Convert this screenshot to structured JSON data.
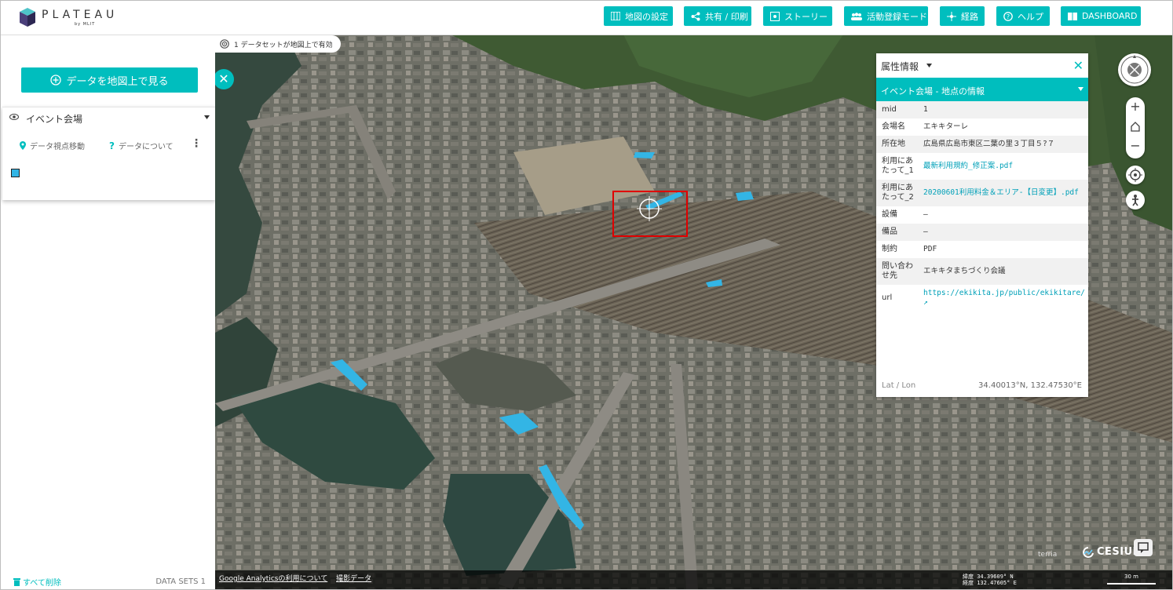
{
  "header": {
    "logo_text": "PLATEAU",
    "logo_sub": "by MLIT",
    "nav": [
      {
        "label": "地図の設定",
        "icon": "map-settings-icon"
      },
      {
        "label": "共有 / 印刷",
        "icon": "share-icon"
      },
      {
        "label": "ストーリー",
        "icon": "story-icon"
      },
      {
        "label": "活動登録モード",
        "icon": "users-icon"
      },
      {
        "label": "経路",
        "icon": "route-icon"
      },
      {
        "label": "ヘルプ",
        "icon": "help-icon"
      },
      {
        "label": "DASHBOARD",
        "icon": "book-icon"
      }
    ]
  },
  "left": {
    "view_button": "データを地図上で見る",
    "dataset": {
      "title": "イベント会場",
      "action_move": "データ視点移動",
      "action_about": "データについて"
    },
    "remove_all": "すべて削除",
    "datasets_count": "DATA SETS 1"
  },
  "map": {
    "active_badge": "1 データセットが地図上で有効",
    "footer_links": [
      "Google Analyticsの利用について",
      "撮影データ"
    ],
    "coords_line1": "緯度      34.39609° N",
    "coords_line2": "経度      132.47605° E",
    "scale": "30 m",
    "brand": "CESIUM",
    "terria": "terria"
  },
  "attr": {
    "title": "属性情報",
    "section": "イベント会場 - 地点の情報",
    "rows": [
      {
        "k": "mid",
        "v": "1"
      },
      {
        "k": "会場名",
        "v": "エキキターレ"
      },
      {
        "k": "所在地",
        "v": "広島県広島市東区二葉の里３丁目５?７"
      },
      {
        "k": "利用にあたって_1",
        "v": "最新利用規約_修正案.pdf"
      },
      {
        "k": "利用にあたって_2",
        "v": "20200601利用料金＆エリア-【日変更】.pdf"
      },
      {
        "k": "設備",
        "v": "—"
      },
      {
        "k": "備品",
        "v": "—"
      },
      {
        "k": "制約",
        "v": "PDF"
      },
      {
        "k": "問い合わせ先",
        "v": "エキキタまちづくり会議"
      },
      {
        "k": "url",
        "v": "https://ekikita.jp/public/ekikitare/"
      }
    ],
    "latlon_label": "Lat / Lon",
    "latlon_value": "34.40013°N, 132.47530°E"
  },
  "colors": {
    "accent": "#00bebe",
    "highlight": "#33b5e5",
    "selection": "#e00000"
  }
}
